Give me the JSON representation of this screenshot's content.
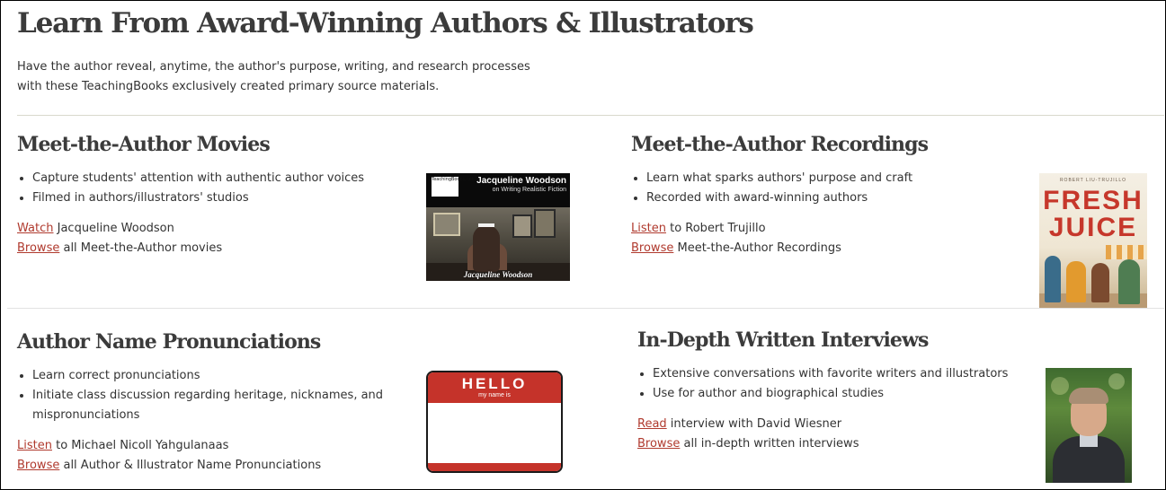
{
  "page": {
    "title": "Learn From Award-Winning Authors & Illustrators",
    "intro_line1": "Have the author reveal, anytime, the author's purpose, writing, and research processes",
    "intro_line2": "with these TeachingBooks exclusively created primary source materials."
  },
  "sections": {
    "movies": {
      "title": "Meet-the-Author Movies",
      "bullets": [
        "Capture students' attention with authentic author voices",
        "Filmed in authors/illustrators' studios"
      ],
      "link1": {
        "label": "Watch",
        "rest": " Jacqueline Woodson"
      },
      "link2": {
        "label": "Browse",
        "rest": " all Meet-the-Author movies"
      },
      "thumb": {
        "name": "Jacqueline Woodson",
        "sub": "on Writing Realistic Fiction",
        "caption": "Jacqueline Woodson",
        "logo": "TeachingBooks.net"
      }
    },
    "recordings": {
      "title": "Meet-the-Author Recordings",
      "bullets": [
        "Learn what sparks authors' purpose and craft",
        "Recorded with award-winning authors"
      ],
      "link1": {
        "label": "Listen",
        "rest": " to Robert Trujillo"
      },
      "link2": {
        "label": "Browse",
        "rest": " Meet-the-Author Recordings"
      },
      "thumb": {
        "author": "ROBERT LIU-TRUJILLO",
        "title1": "FRESH",
        "title2": "JUICE"
      }
    },
    "pronunciations": {
      "title": "Author Name Pronunciations",
      "bullets": [
        "Learn correct pronunciations",
        "Initiate class discussion regarding heritage, nicknames, and",
        "mispronunciations"
      ],
      "link1": {
        "label": "Listen",
        "rest": " to Michael Nicoll Yahgulanaas"
      },
      "link2": {
        "label": "Browse",
        "rest": " all Author & Illustrator Name Pronunciations"
      },
      "thumb": {
        "hello": "HELLO",
        "sub": "my name is"
      }
    },
    "interviews": {
      "title": "In-Depth Written Interviews",
      "bullets": [
        "Extensive conversations with favorite writers and illustrators",
        "Use for author and biographical studies"
      ],
      "link1": {
        "label": "Read",
        "rest": " interview with David Wiesner"
      },
      "link2": {
        "label": "Browse",
        "rest": " all in-depth written interviews"
      }
    }
  },
  "colors": {
    "link": "#b03a2e",
    "heading": "#3b3b3b",
    "divider": "#d8d8cc",
    "hello_red": "#c5332a"
  }
}
